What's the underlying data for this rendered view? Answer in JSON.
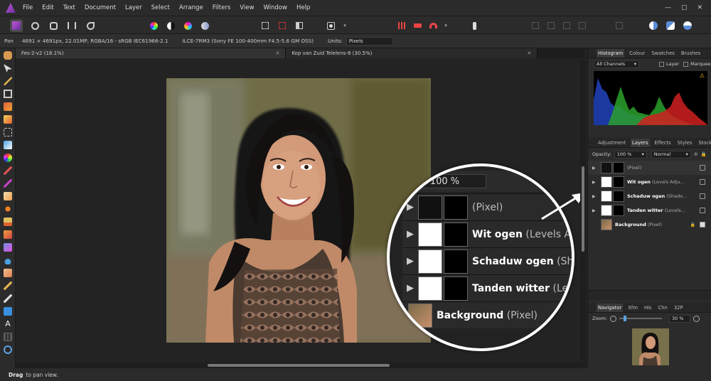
{
  "menu": [
    "File",
    "Edit",
    "Text",
    "Document",
    "Layer",
    "Select",
    "Arrange",
    "Filters",
    "View",
    "Window",
    "Help"
  ],
  "window_controls": {
    "minimize": "—",
    "maximize": "▢",
    "close": "✕"
  },
  "context": {
    "tool_name": "Pan",
    "doc_info": "4691 × 4691px, 22.01MP, RGBA/16 - sRGB IEC61966-2.1",
    "camera": "ILCE-7RM3 (Sony FE 100-400mm F4.5-5.6 GM OSS)",
    "units_label": "Units:",
    "units_value": "Pixels"
  },
  "tabs": [
    {
      "label": "Fes-2-v2 (18.1%)",
      "close": "✕"
    },
    {
      "label": "Kop van Zuid Telelens-8 (30.5%)",
      "close": "✕"
    }
  ],
  "status": {
    "action": "Drag",
    "text": "to pan view."
  },
  "histogram_panel": {
    "tabs": [
      "Histogram",
      "Colour",
      "Swatches",
      "Brushes"
    ],
    "channels": "All Channels",
    "layer_label": "Layer",
    "marquee_label": "Marquee",
    "warning_icon": "warning-icon"
  },
  "layers_panel": {
    "tabs": [
      "Adjustment",
      "Layers",
      "Effects",
      "Styles",
      "Stock"
    ],
    "opacity_label": "Opacity:",
    "opacity_value": "100 %",
    "blend_mode": "Normal",
    "layers": [
      {
        "name": "",
        "kind": "(Pixel)"
      },
      {
        "name": "Wit ogen",
        "kind": "(Levels Adju..."
      },
      {
        "name": "Schaduw ogen",
        "kind": "(Shado..."
      },
      {
        "name": "Tanden witter",
        "kind": "(Levels..."
      },
      {
        "name": "Background",
        "kind": "(Pixel)"
      }
    ]
  },
  "magnifier": {
    "opacity_label": "ity:",
    "opacity_value": "100 %",
    "rows": [
      {
        "name": "",
        "kind": "(Pixel)"
      },
      {
        "name": "Wit ogen",
        "kind": "(Levels A"
      },
      {
        "name": "Schaduw ogen",
        "kind": "(Sha"
      },
      {
        "name": "Tanden witter",
        "kind": "(Lev"
      },
      {
        "name": "Background",
        "kind": "(Pixel)"
      }
    ]
  },
  "navigator_panel": {
    "tabs": [
      "Navigator",
      "Xfm",
      "His",
      "Chn",
      "32P"
    ],
    "zoom_label": "Zoom:",
    "zoom_value": "30 %"
  }
}
